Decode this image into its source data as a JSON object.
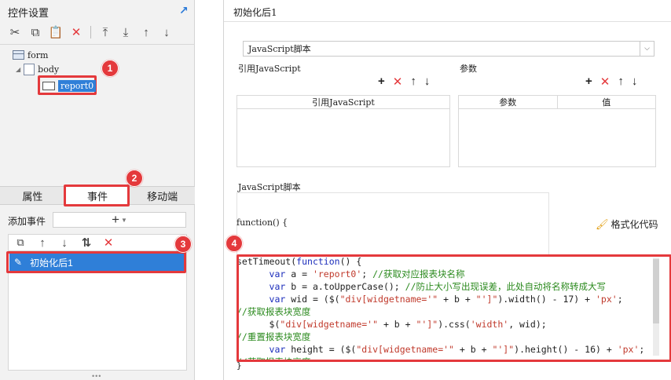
{
  "left_panel": {
    "title": "控件设置",
    "tree": {
      "form": "form",
      "body": "body",
      "report": "report0"
    },
    "tabs": [
      "属性",
      "事件",
      "移动端"
    ],
    "add_event_label": "添加事件",
    "add_event_button": "+",
    "events": [
      "初始化后1"
    ]
  },
  "right_panel": {
    "title": "初始化后1",
    "type_select": "JavaScript脚本",
    "ref_js_label": "引用JavaScript",
    "ref_js_column": "引用JavaScript",
    "params_label": "参数",
    "params_columns": [
      "参数",
      "值"
    ],
    "script_label": "JavaScript脚本",
    "function_open": "function() {",
    "function_close": "}",
    "format_button": "格式化代码",
    "code_lines": [
      [
        [
          "plain",
          "setTimeout("
        ],
        [
          "kw",
          "function"
        ],
        [
          "plain",
          "() {"
        ]
      ],
      [
        [
          "plain",
          "      "
        ],
        [
          "kw",
          "var"
        ],
        [
          "plain",
          " a = "
        ],
        [
          "str",
          "'report0'"
        ],
        [
          "plain",
          "; "
        ],
        [
          "cm",
          "//获取对应报表块名称"
        ]
      ],
      [
        [
          "plain",
          "      "
        ],
        [
          "kw",
          "var"
        ],
        [
          "plain",
          " b = a.toUpperCase(); "
        ],
        [
          "cm",
          "//防止大小写出现误差，此处自动将名称转成大写"
        ]
      ],
      [
        [
          "plain",
          "      "
        ],
        [
          "kw",
          "var"
        ],
        [
          "plain",
          " wid = ($("
        ],
        [
          "str",
          "\"div[widgetname='\""
        ],
        [
          "plain",
          " + b + "
        ],
        [
          "str",
          "\"']\""
        ],
        [
          "plain",
          ").width() - 17) + "
        ],
        [
          "str",
          "'px'"
        ],
        [
          "plain",
          ";"
        ]
      ],
      [
        [
          "cm",
          "//获取报表块宽度"
        ]
      ],
      [
        [
          "plain",
          "      $("
        ],
        [
          "str",
          "\"div[widgetname='\""
        ],
        [
          "plain",
          " + b + "
        ],
        [
          "str",
          "\"']\""
        ],
        [
          "plain",
          ").css("
        ],
        [
          "str",
          "'width'"
        ],
        [
          "plain",
          ", wid);"
        ]
      ],
      [
        [
          "cm",
          "//重置报表块宽度"
        ]
      ],
      [
        [
          "plain",
          "      "
        ],
        [
          "kw",
          "var"
        ],
        [
          "plain",
          " height = ($("
        ],
        [
          "str",
          "\"div[widgetname='\""
        ],
        [
          "plain",
          " + b + "
        ],
        [
          "str",
          "\"']\""
        ],
        [
          "plain",
          ").height() - 16) + "
        ],
        [
          "str",
          "'px'"
        ],
        [
          "plain",
          ";"
        ]
      ],
      [
        [
          "cm",
          "//获取报表块高度"
        ]
      ]
    ]
  },
  "annotations": [
    "1",
    "2",
    "3",
    "4"
  ],
  "colors": {
    "highlight_red": "#e4393c",
    "selection_blue": "#2f7fd8",
    "keyword_blue": "#1c2dbb",
    "string_red": "#c0392b",
    "comment_green": "#2b8a1e"
  }
}
